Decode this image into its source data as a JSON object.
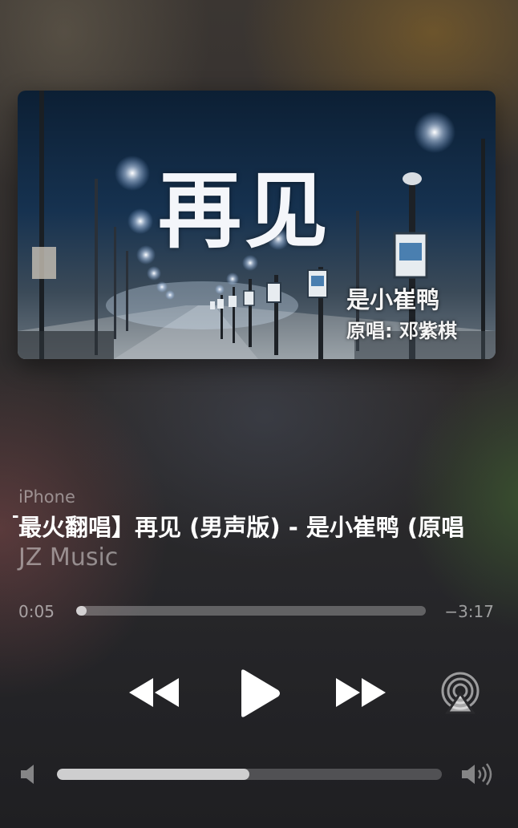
{
  "artwork": {
    "title": "再见",
    "artist_line": "是小崔鸭",
    "original_line": "原唱: 邓紫棋"
  },
  "now_playing": {
    "device": "iPhone",
    "title": "「最火翻唱】再见 (男声版) - 是小崔鸭 (原唱",
    "artist": "JZ Music"
  },
  "progress": {
    "elapsed": "0:05",
    "remaining": "−3:17",
    "fraction": 0.03
  },
  "controls": {
    "rewind_icon": "rewind-icon",
    "play_icon": "play-icon",
    "forward_icon": "fast-forward-icon",
    "airplay_icon": "airplay-icon"
  },
  "volume": {
    "level": 0.5,
    "min_icon": "volume-min-icon",
    "max_icon": "volume-max-icon"
  }
}
